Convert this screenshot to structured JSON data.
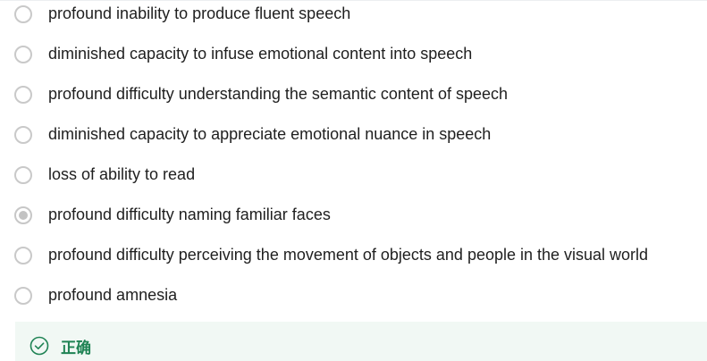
{
  "quiz": {
    "options": [
      {
        "label": "profound inability to produce fluent speech",
        "selected": false
      },
      {
        "label": "diminished capacity to infuse emotional content into speech",
        "selected": false
      },
      {
        "label": "profound difficulty understanding the semantic content of speech",
        "selected": false
      },
      {
        "label": "diminished capacity to appreciate emotional nuance in speech",
        "selected": false
      },
      {
        "label": "loss of ability to read",
        "selected": false
      },
      {
        "label": "profound difficulty naming familiar faces",
        "selected": true
      },
      {
        "label": "profound difficulty perceiving the movement of objects and people in the visual world",
        "selected": false
      },
      {
        "label": "profound amnesia",
        "selected": false
      }
    ]
  },
  "feedback": {
    "text": "正确",
    "icon": "check-circle-icon",
    "color": "#1f8354",
    "background": "#f1f8f4"
  }
}
